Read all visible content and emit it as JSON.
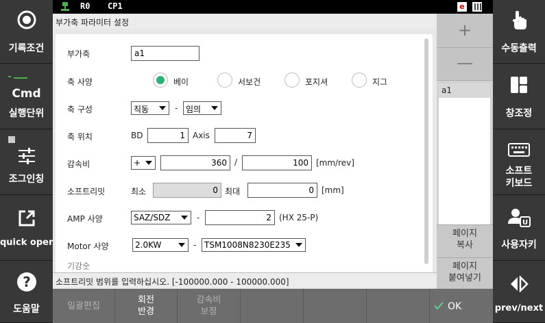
{
  "statusbar": {
    "r0": "R0",
    "cp1": "CP1",
    "e_badge": "e"
  },
  "left_sidebar": {
    "items": [
      {
        "label": "기록조건"
      },
      {
        "label": "실행단위",
        "badge": "Cmd"
      },
      {
        "label": "조그인칭"
      },
      {
        "label": "quick open"
      },
      {
        "label": "도움말"
      }
    ]
  },
  "right_sidebar": {
    "items": [
      {
        "label": "수동출력"
      },
      {
        "label": "창조정"
      },
      {
        "label_line1": "소프트",
        "label_line2": "키보드"
      },
      {
        "label": "사용자키"
      },
      {
        "label": "prev/next"
      }
    ]
  },
  "dialog": {
    "title": "부가축 파라미터 설정",
    "axis_name_label": "부가축",
    "axis_name_value": "a1",
    "axis_spec_label": "축 사양",
    "axis_spec_options": [
      "베이",
      "서보건",
      "포지셔",
      "지그"
    ],
    "axis_spec_selected": "베이",
    "axis_config_label": "축 구성",
    "axis_config_sel1": "직동",
    "axis_config_dash": "-",
    "axis_config_sel2": "임의",
    "axis_pos_label": "축 위치",
    "axis_pos_bd_label": "BD",
    "axis_pos_bd_value": "1",
    "axis_pos_axis_label": "Axis",
    "axis_pos_axis_value": "7",
    "reduction_label": "감속비",
    "reduction_sign": "+",
    "reduction_num": "360",
    "reduction_slash": "/",
    "reduction_den": "100",
    "reduction_unit": "[mm/rev]",
    "softlimit_label": "소프트리밋",
    "softlimit_min_label": "최소",
    "softlimit_min_value": "0",
    "softlimit_max_label": "최대",
    "softlimit_max_value": "0",
    "softlimit_unit": "[mm]",
    "amp_label": "AMP 사양",
    "amp_sel": "SAZ/SDZ",
    "amp_dash": "-",
    "amp_value": "2",
    "amp_note": "(HX 25-P)",
    "motor_label": "Motor 사양",
    "motor_sel1": "2.0KW",
    "motor_dash": "-",
    "motor_sel2": "TSM1008N8230E235",
    "cut_label": "기강숫"
  },
  "hint": "소프트리밋 범위를 입력하십시오. [-100000.000 - 100000.000]",
  "list_panel": {
    "plus": "+",
    "minus": "—",
    "items": [
      "a1"
    ],
    "page_copy_line1": "페이지",
    "page_copy_line2": "복사",
    "page_paste_line1": "페이지",
    "page_paste_line2": "붙여넣기"
  },
  "bottombar": {
    "batch_edit": "일괄편집",
    "rotate_line1": "회전",
    "rotate_line2": "반경",
    "reduction_line1": "감속비",
    "reduction_line2": "보정",
    "ok": "OK"
  },
  "colors": {
    "radio_selected": "#2db37a",
    "background_dark": "#333333"
  }
}
